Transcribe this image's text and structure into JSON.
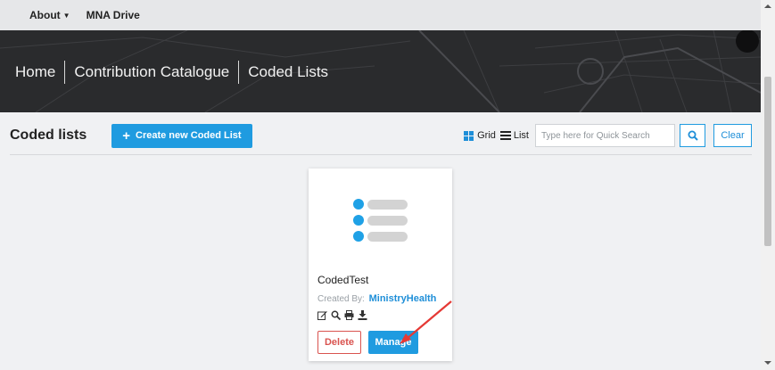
{
  "topnav": {
    "items": [
      {
        "label": "About",
        "has_caret": true
      },
      {
        "label": "MNA Drive",
        "has_caret": false
      }
    ]
  },
  "banner": {
    "breadcrumbs": [
      "Home",
      "Contribution Catalogue",
      "Coded Lists"
    ]
  },
  "toolbar": {
    "title": "Coded lists",
    "create_button": "Create new Coded List",
    "view_grid": "Grid",
    "view_list": "List",
    "search_placeholder": "Type here for Quick Search",
    "search_value": "",
    "clear_button": "Clear"
  },
  "card": {
    "title": "CodedTest",
    "created_by_label": "Created By:",
    "created_by_value": "MinistryHealth",
    "action_icons": [
      "edit-icon",
      "search-icon",
      "print-icon",
      "download-icon"
    ],
    "delete_button": "Delete",
    "manage_button": "Manage"
  },
  "colors": {
    "accent": "#1f9be0",
    "danger": "#d9534f",
    "banner_bg": "#2b2c2e",
    "annotation": "#e53935"
  }
}
